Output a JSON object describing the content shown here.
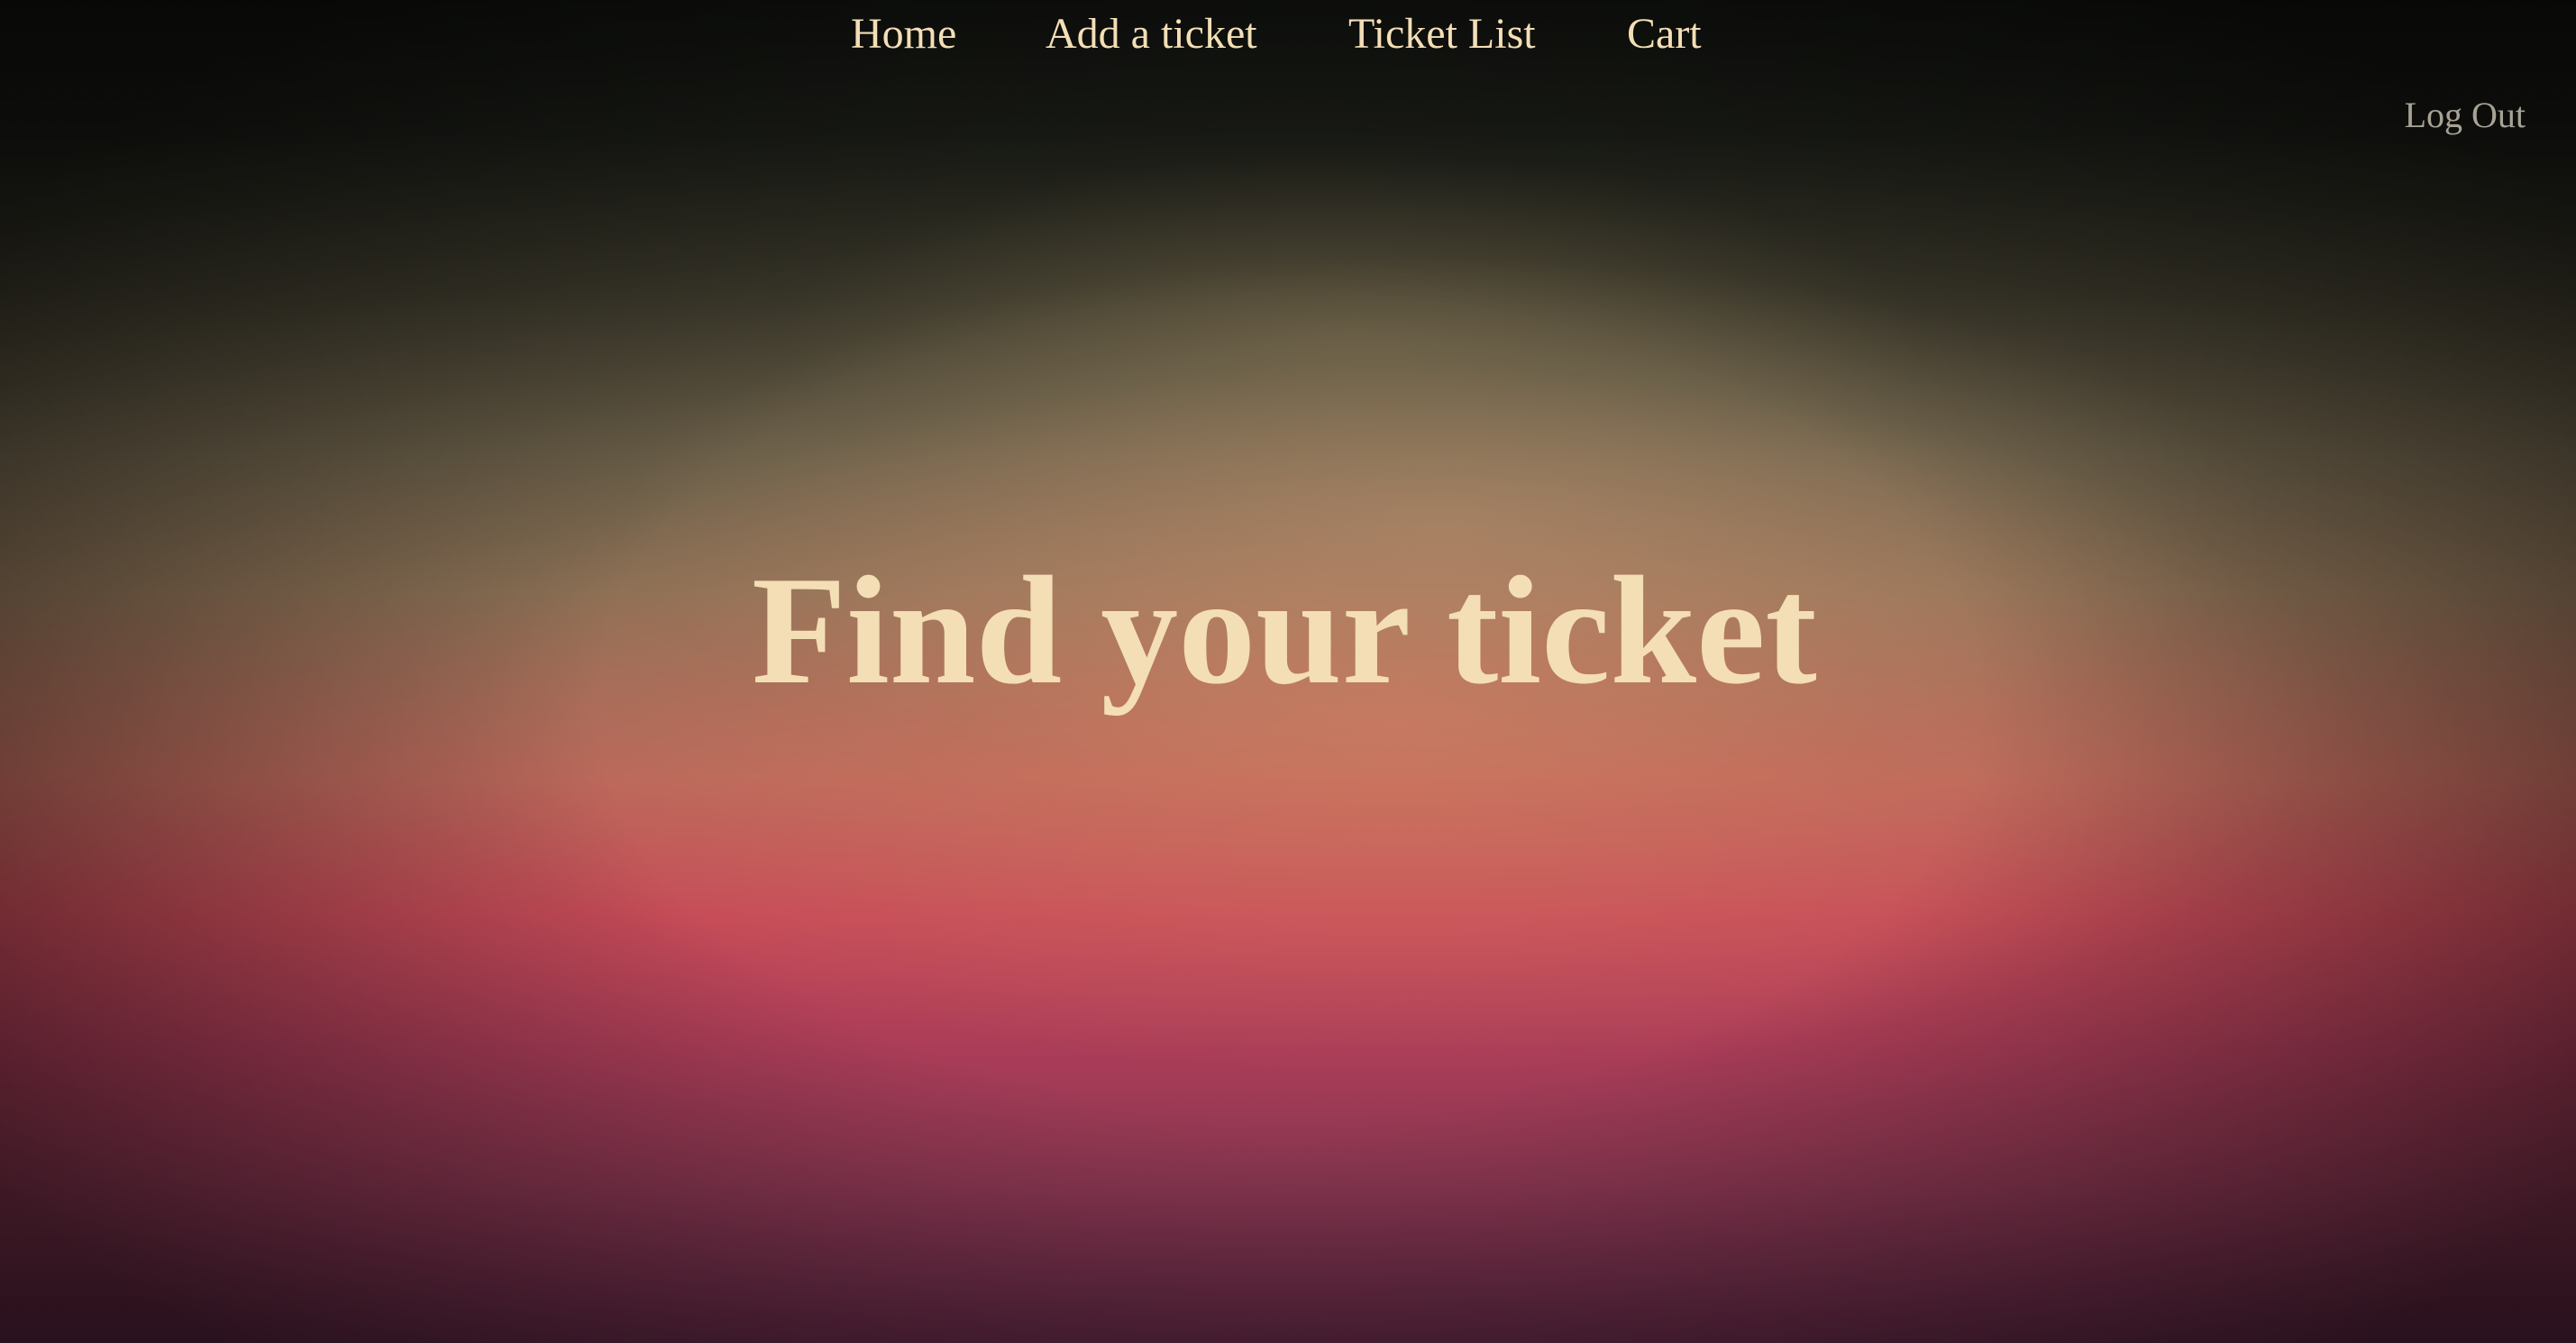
{
  "nav": {
    "items": [
      {
        "label": "Home"
      },
      {
        "label": "Add a ticket"
      },
      {
        "label": "Ticket List"
      },
      {
        "label": "Cart"
      }
    ],
    "logout_label": "Log Out"
  },
  "hero": {
    "title": "Find your ticket"
  },
  "colors": {
    "nav_text": "#f3deb6",
    "logout_text": "#a7a295",
    "title_text": "#f3deb6"
  }
}
